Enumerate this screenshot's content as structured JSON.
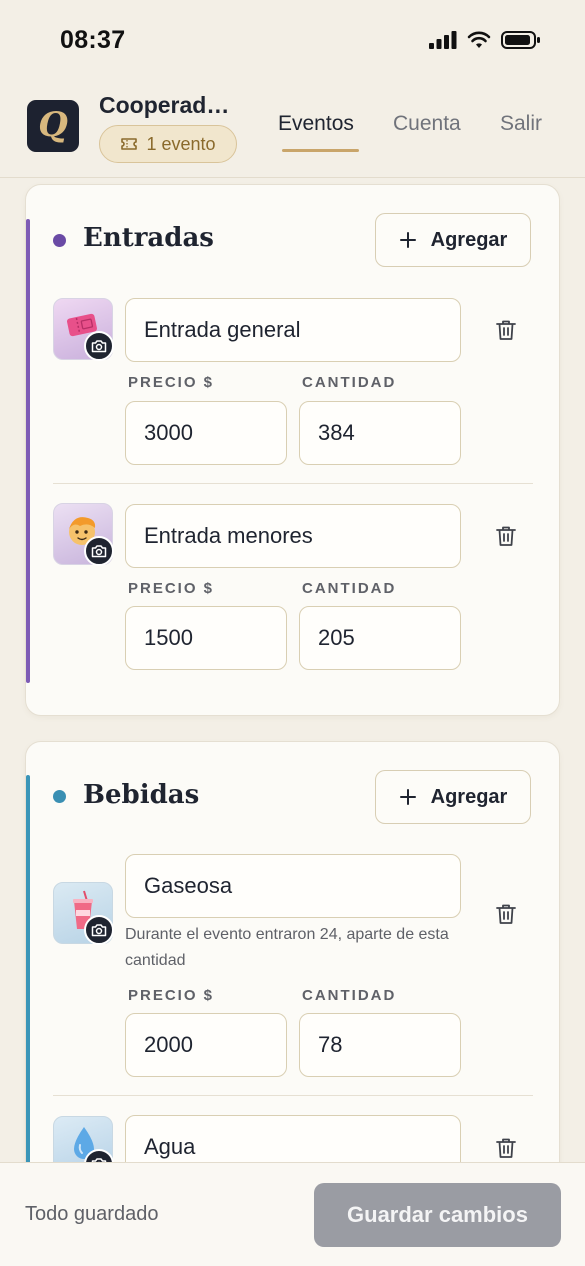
{
  "status_bar": {
    "time": "08:37"
  },
  "header": {
    "org_name": "Cooperad…",
    "event_badge": "1 evento",
    "tabs": [
      {
        "label": "Eventos",
        "active": true
      },
      {
        "label": "Cuenta",
        "active": false
      },
      {
        "label": "Salir",
        "active": false
      }
    ]
  },
  "sections": [
    {
      "title": "Entradas",
      "accent_color": "#7d5bb5",
      "add_label": "Agregar",
      "items": [
        {
          "name": "Entrada general",
          "price_label": "PRECIO $",
          "price": "3000",
          "qty_label": "CANTIDAD",
          "qty": "384",
          "icon": "ticket-icon"
        },
        {
          "name": "Entrada menores",
          "price_label": "PRECIO $",
          "price": "1500",
          "qty_label": "CANTIDAD",
          "qty": "205",
          "icon": "child-icon"
        }
      ]
    },
    {
      "title": "Bebidas",
      "accent_color": "#3a95b8",
      "add_label": "Agregar",
      "items": [
        {
          "name": "Gaseosa",
          "hint": "Durante el evento entraron 24, aparte de esta cantidad",
          "price_label": "PRECIO $",
          "price": "2000",
          "qty_label": "CANTIDAD",
          "qty": "78",
          "icon": "soda-cup-icon"
        },
        {
          "name": "Agua",
          "icon": "water-drop-icon"
        }
      ]
    }
  ],
  "footer": {
    "status": "Todo guardado",
    "save_label": "Guardar cambios"
  }
}
